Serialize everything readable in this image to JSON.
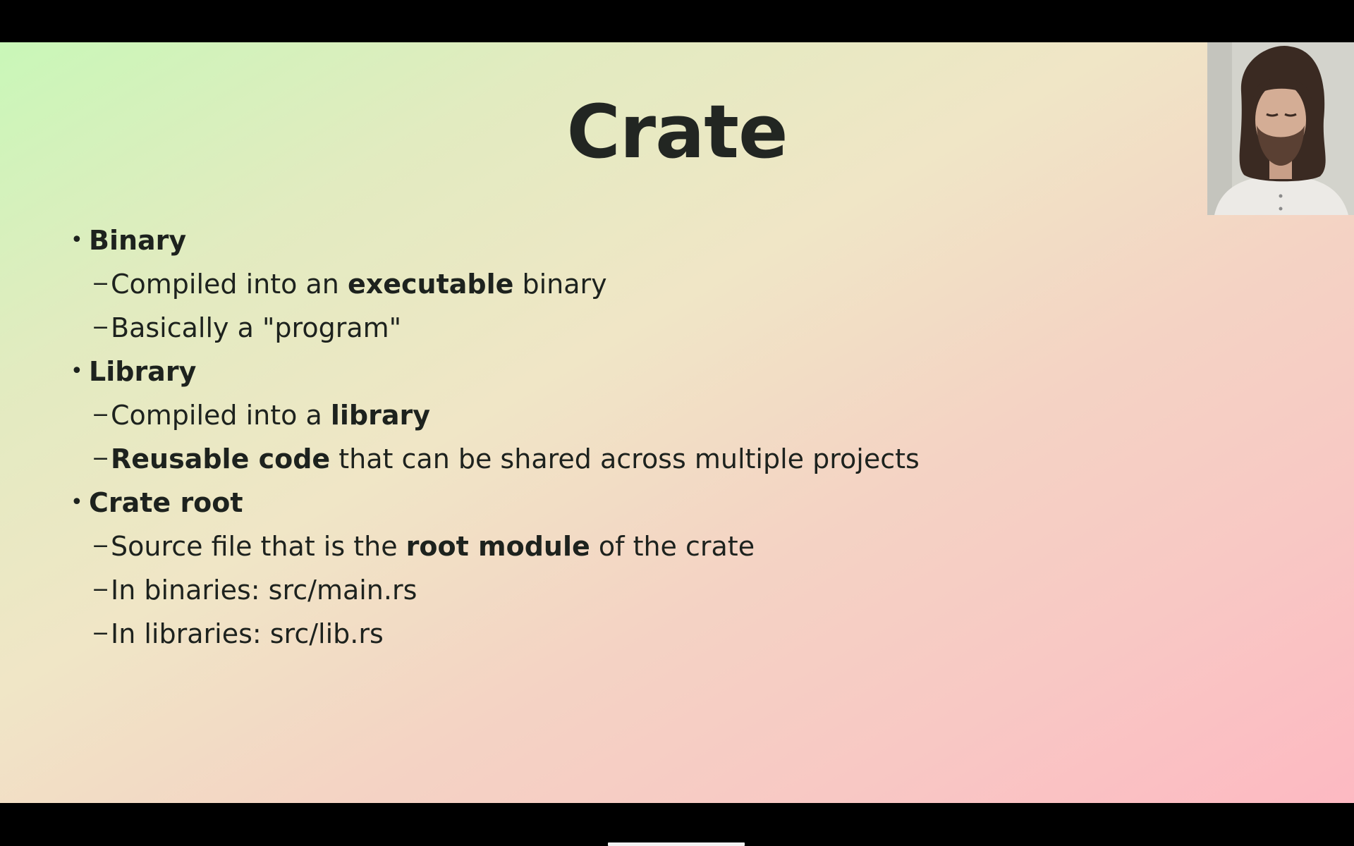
{
  "slide": {
    "title": "Crate",
    "items": [
      {
        "label": "Binary",
        "subitems": [
          {
            "pre": "Compiled into an ",
            "bold": "executable",
            "post": " binary"
          },
          {
            "pre": "Basically a \"program\"",
            "bold": "",
            "post": ""
          }
        ]
      },
      {
        "label": "Library",
        "subitems": [
          {
            "pre": "Compiled into a ",
            "bold": "library",
            "post": ""
          },
          {
            "pre": "",
            "bold": "Reusable code",
            "post": " that can be shared across multiple projects"
          }
        ]
      },
      {
        "label": "Crate root",
        "subitems": [
          {
            "pre": "Source file that is the ",
            "bold": "root module",
            "post": " of the crate"
          },
          {
            "pre": "In binaries: src/main.rs",
            "bold": "",
            "post": ""
          },
          {
            "pre": "In libraries: src/lib.rs",
            "bold": "",
            "post": ""
          }
        ]
      }
    ],
    "bullet_glyph": "•",
    "dash_glyph": "−"
  },
  "webcam": {
    "icon": "presenter-webcam-icon"
  },
  "colors": {
    "background_gradient": [
      "#c9f7b8",
      "#e2ebc0",
      "#f0e6c6",
      "#f4d3c4",
      "#f8c8c4",
      "#fdb9c2"
    ],
    "text": "#1d221e",
    "frame": "#000000"
  }
}
